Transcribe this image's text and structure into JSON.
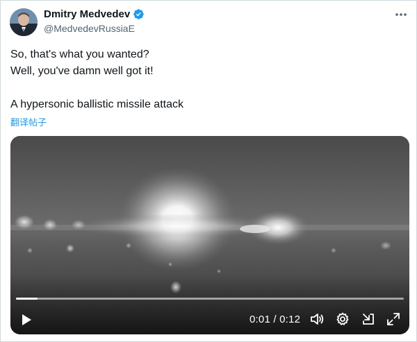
{
  "author": {
    "display_name": "Dmitry Medvedev",
    "handle": "@MedvedevRussiaE",
    "verified_icon": "verified-badge-icon",
    "avatar_icon": "profile-avatar"
  },
  "more_icon": "more-options-icon",
  "tweet": {
    "line1": "So, that's what you wanted?",
    "line2": "Well, you've damn well got it!",
    "line3": "A hypersonic ballistic missile attack"
  },
  "translate_label": "翻译帖子",
  "video": {
    "current_time": "0:01",
    "separator": "/",
    "duration": "0:12",
    "progress_fraction": 0.055,
    "play_icon": "play-icon",
    "volume_icon": "volume-icon",
    "settings_icon": "settings-gear-icon",
    "popout_icon": "popout-icon",
    "fullscreen_icon": "fullscreen-icon"
  },
  "colors": {
    "link_blue": "#1d9bf0",
    "text_primary": "#0f1419",
    "text_secondary": "#536471",
    "verified_blue": "#1d9bf0"
  }
}
